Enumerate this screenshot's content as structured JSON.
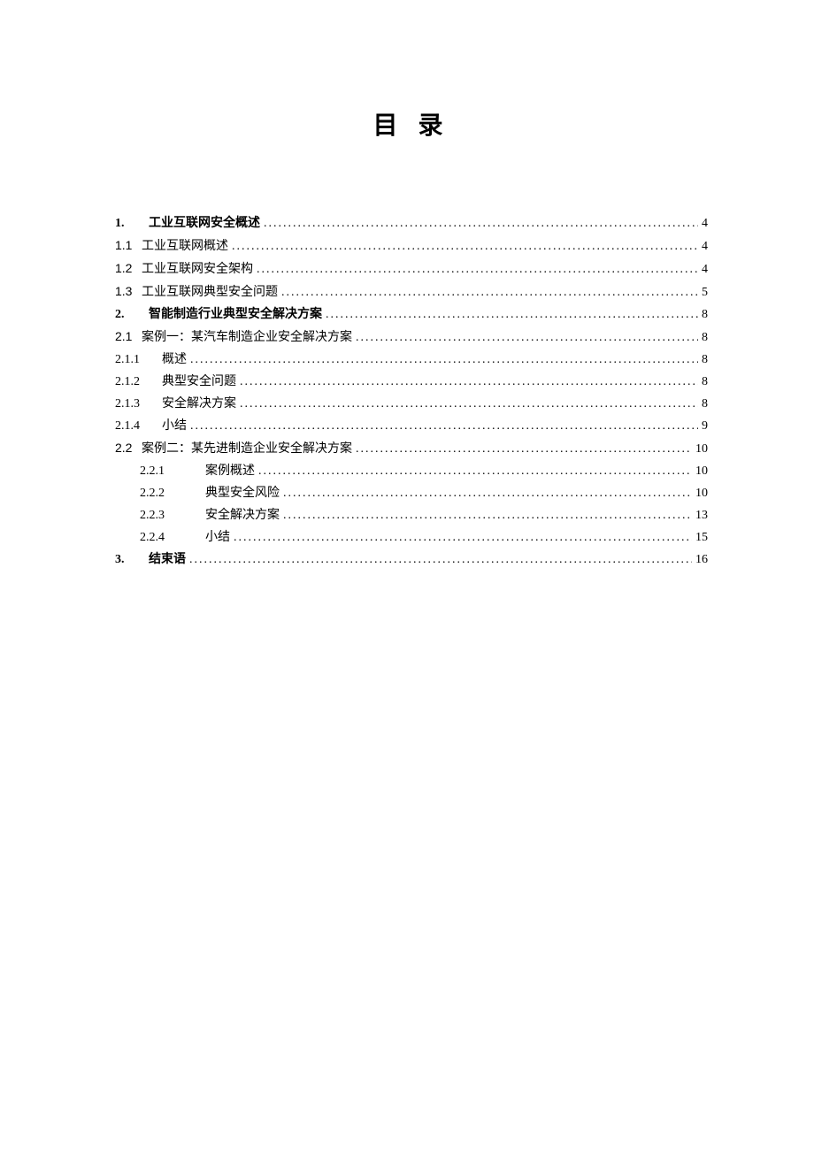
{
  "title": "目 录",
  "entries": [
    {
      "num": "1.",
      "label": "工业互联网安全概述",
      "page": "4",
      "cls": "toc-entry bold indent-0"
    },
    {
      "num": "1.1",
      "label": "工业互联网概述",
      "page": "4",
      "cls": "toc-entry l1 indent-0b"
    },
    {
      "num": "1.2",
      "label": "工业互联网安全架构",
      "page": "4",
      "cls": "toc-entry l1 indent-0b"
    },
    {
      "num": "1.3",
      "label": "工业互联网典型安全问题",
      "page": "5",
      "cls": "toc-entry l1 indent-0b"
    },
    {
      "num": "2.",
      "label": "智能制造行业典型安全解决方案",
      "page": "8",
      "cls": "toc-entry bold indent-0"
    },
    {
      "num": "2.1",
      "label": "案例一：某汽车制造企业安全解决方案",
      "page": "8",
      "cls": "toc-entry l1 indent-0b"
    },
    {
      "num": "2.1.1",
      "label": "概述",
      "page": "8",
      "cls": "toc-entry l2 indent-1"
    },
    {
      "num": "2.1.2",
      "label": "典型安全问题",
      "page": "8",
      "cls": "toc-entry l2 indent-1"
    },
    {
      "num": "2.1.3",
      "label": "安全解决方案",
      "page": "8",
      "cls": "toc-entry l2 indent-1"
    },
    {
      "num": "2.1.4",
      "label": "小结",
      "page": "9",
      "cls": "toc-entry l2 indent-1"
    },
    {
      "num": "2.2",
      "label": "案例二：某先进制造企业安全解决方案",
      "page": "10",
      "cls": "toc-entry l1 indent-0b"
    },
    {
      "num": "2.2.1",
      "label": "案例概述",
      "page": "10",
      "cls": "toc-entry l2 indent-2"
    },
    {
      "num": "2.2.2",
      "label": "典型安全风险",
      "page": "10",
      "cls": "toc-entry l2 indent-2"
    },
    {
      "num": "2.2.3",
      "label": "安全解决方案",
      "page": "13",
      "cls": "toc-entry l2 indent-2"
    },
    {
      "num": "2.2.4",
      "label": "小结",
      "page": "15",
      "cls": "toc-entry l2 indent-2"
    },
    {
      "num": "3.",
      "label": "结束语",
      "page": "16",
      "cls": "toc-entry bold indent-0"
    }
  ]
}
